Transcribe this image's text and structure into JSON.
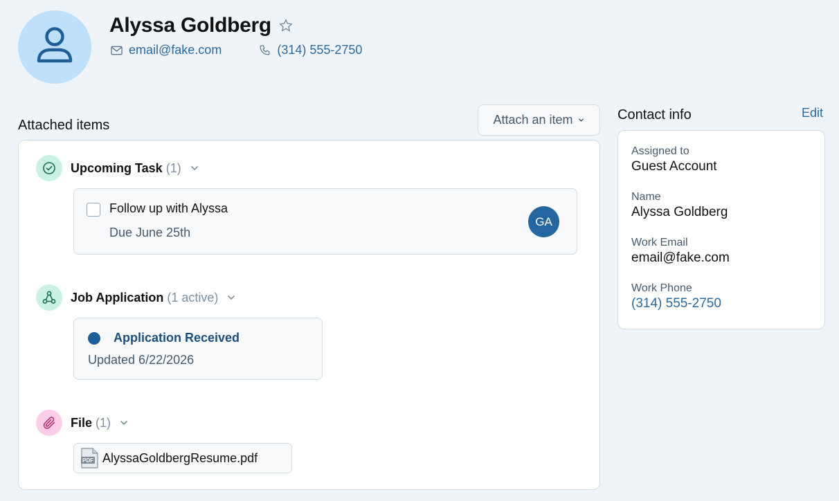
{
  "header": {
    "name": "Alyssa Goldberg",
    "email": "email@fake.com",
    "phone": "(314) 555-2750",
    "icons": [
      "user-icon",
      "star-icon",
      "mail-icon",
      "phone-icon"
    ]
  },
  "attached": {
    "title": "Attached items",
    "attach_button": "Attach an item",
    "task_group": {
      "label": "Upcoming Task",
      "count": "(1)",
      "task_title": "Follow up with Alyssa",
      "task_due": "Due June 25th",
      "assignee_initials": "GA"
    },
    "job_group": {
      "label": "Job Application",
      "count": "(1 active)",
      "status": "Application Received",
      "updated": "Updated 6/22/2026"
    },
    "file_group": {
      "label": "File",
      "count": "(1)",
      "file_name": "AlyssaGoldbergResume.pdf",
      "file_icon_text": "PDF"
    }
  },
  "contact_info": {
    "title": "Contact info",
    "edit_label": "Edit",
    "fields": [
      {
        "label": "Assigned to",
        "value": "Guest Account"
      },
      {
        "label": "Name",
        "value": "Alyssa Goldberg"
      },
      {
        "label": "Work Email",
        "value": "email@fake.com"
      },
      {
        "label": "Work Phone",
        "value": "(314) 555-2750"
      }
    ]
  },
  "colors": {
    "accent": "#2b6a9c",
    "avatar_bg": "#bfe0fb",
    "task_icon_bg": "#c9f2e5",
    "file_icon_bg": "#fbcde7",
    "status_dot": "#1f5f98",
    "page_bg": "#eff4f9"
  }
}
